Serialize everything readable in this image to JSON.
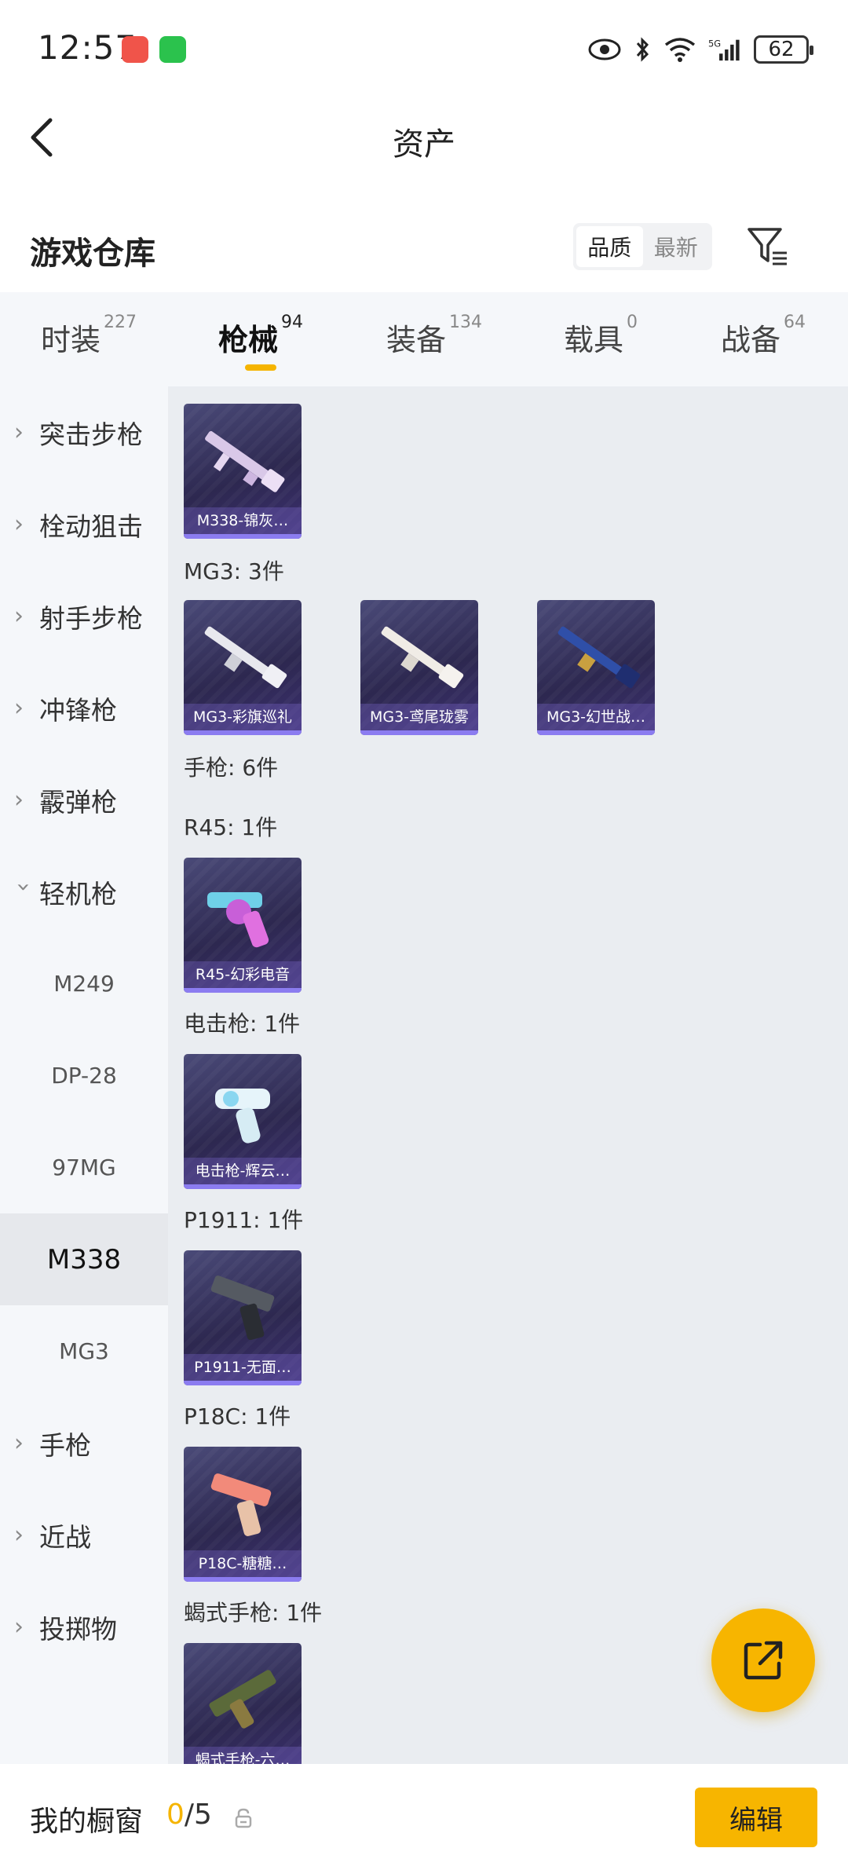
{
  "status": {
    "time": "12:57",
    "battery": "62"
  },
  "header": {
    "title": "资产"
  },
  "warehouse": {
    "title": "游戏仓库",
    "sort_options": [
      "品质",
      "最新"
    ]
  },
  "tabs": [
    {
      "label": "时装",
      "count": "227"
    },
    {
      "label": "枪械",
      "count": "94"
    },
    {
      "label": "装备",
      "count": "134"
    },
    {
      "label": "载具",
      "count": "0"
    },
    {
      "label": "战备",
      "count": "64"
    }
  ],
  "sidebar": {
    "categories": [
      "突击步枪",
      "栓动狙击",
      "射手步枪",
      "冲锋枪",
      "霰弹枪",
      "轻机枪"
    ],
    "subitems": [
      "M249",
      "DP-28",
      "97MG",
      "M338",
      "MG3"
    ],
    "more": [
      "手枪",
      "近战",
      "投掷物"
    ]
  },
  "content": {
    "groups": [
      {
        "label": "MG3: 3件"
      },
      {
        "label": "手枪: 6件"
      },
      {
        "label": "R45: 1件"
      },
      {
        "label": "电击枪: 1件"
      },
      {
        "label": "P1911: 1件"
      },
      {
        "label": "P18C: 1件"
      },
      {
        "label": "蝎式手枪: 1件"
      }
    ],
    "cards": [
      "M338-锦灰…",
      "MG3-彩旗巡礼",
      "MG3-鸢尾珑雾",
      "MG3-幻世战…",
      "R45-幻彩电音",
      "电击枪-辉云…",
      "P1911-无面…",
      "P18C-糖糖…",
      "蝎式手枪-六…"
    ]
  },
  "bottom": {
    "label": "我的橱窗",
    "count_current": "0",
    "count_total": "/5",
    "edit_label": "编辑"
  },
  "colors": {
    "accent": "#f7b500",
    "card_bg": "#2d2850"
  }
}
